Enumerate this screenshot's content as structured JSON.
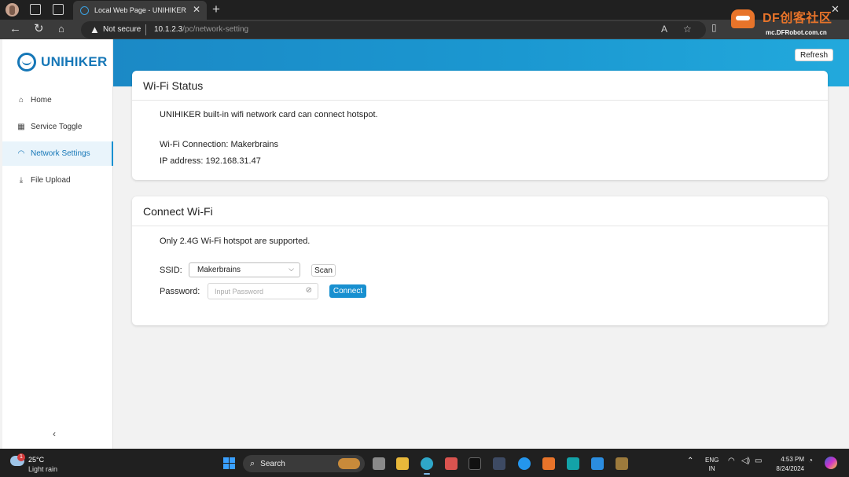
{
  "browser": {
    "tab_title": "Local Web Page - UNIHIKER",
    "security_label": "Not secure",
    "url_host": "10.1.2.3",
    "url_path": "/pc/network-setting",
    "watermark_brand": "DF创客社区",
    "watermark_sub": "mc.DFRobot.com.cn"
  },
  "sidebar": {
    "logo_text": "UNIHIKER",
    "items": [
      {
        "label": "Home",
        "icon": "home-icon"
      },
      {
        "label": "Service Toggle",
        "icon": "grid-icon"
      },
      {
        "label": "Network Settings",
        "icon": "wifi-icon",
        "active": true
      },
      {
        "label": "File Upload",
        "icon": "upload-icon"
      }
    ],
    "collapse_glyph": "‹"
  },
  "header": {
    "refresh_label": "Refresh"
  },
  "wifi_status": {
    "title": "Wi-Fi Status",
    "description": "UNIHIKER built-in wifi network card can connect hotspot.",
    "connection": "Wi-Fi Connection: Makerbrains",
    "ip": "IP address: 192.168.31.47"
  },
  "connect_wifi": {
    "title": "Connect Wi-Fi",
    "note": "Only 2.4G Wi-Fi hotspot are supported.",
    "ssid_label": "SSID:",
    "ssid_value": "Makerbrains",
    "scan_label": "Scan",
    "password_label": "Password:",
    "password_placeholder": "Input Password",
    "connect_label": "Connect"
  },
  "taskbar": {
    "temperature": "25°C",
    "condition": "Light rain",
    "weather_badge": "1",
    "search_label": "Search",
    "language_line1": "ENG",
    "language_line2": "IN",
    "time": "4:53 PM",
    "date": "8/24/2024"
  },
  "colors": {
    "accent": "#1890d0",
    "brand": "#1677b7",
    "watermark": "#e8742a"
  }
}
